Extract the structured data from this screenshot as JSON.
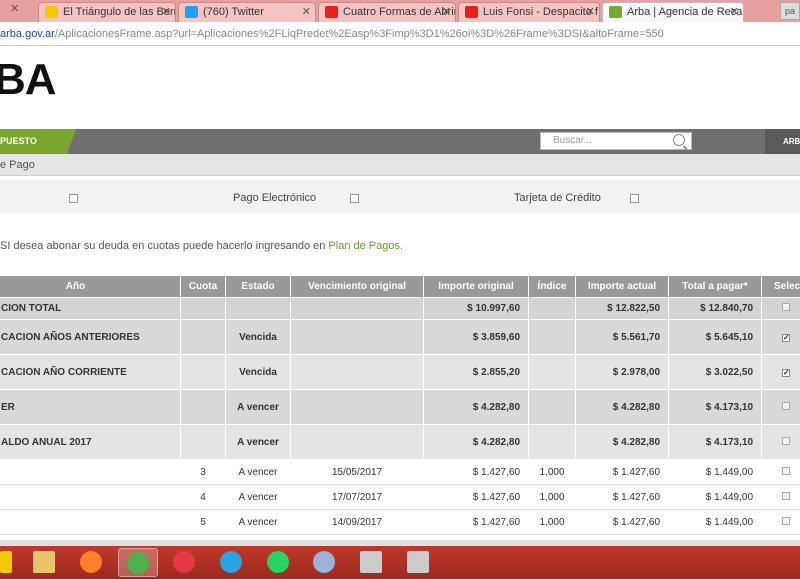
{
  "browser": {
    "tabs": [
      {
        "title": "El Triángulo de las Berm",
        "icon_color": "#f5c800"
      },
      {
        "title": "(760) Twitter",
        "icon_color": "#1da1f2"
      },
      {
        "title": "Cuatro Formas de Abrir",
        "icon_color": "#e62117"
      },
      {
        "title": "Luis Fonsi - Despacito f",
        "icon_color": "#e62117"
      },
      {
        "title": "Arba | Agencia de Recau",
        "icon_color": "#7aa62f",
        "active": true
      }
    ],
    "url_host": "arba.gov.ar",
    "url_path": "/AplicacionesFrame.asp?url=Aplicaciones%2FLiqPredet%2Easp%3Fimp%3D1%26oi%3D%26Frame%3DSI&altoFrame=550",
    "extension_label": "pa"
  },
  "site": {
    "logo": "BA",
    "nav_label": "PUESTO",
    "search_placeholder": "Buscar...",
    "nav_right_label": "ARB",
    "breadcrumb": "e Pago"
  },
  "payment_options": {
    "electronic_label": "Pago Electrónico",
    "card_label": "Tarjeta de Crédito"
  },
  "info": {
    "text": "SI desea abonar su deuda en cuotas puede hacerlo ingresando en",
    "link": "Plan de Pagos."
  },
  "table": {
    "headers": [
      "Año",
      "Cuota",
      "Estado",
      "Vencimiento original",
      "Importe original",
      "Índice",
      "Importe actual",
      "Total a pagar*",
      "Selec"
    ],
    "rows": [
      {
        "kind": "sum",
        "anio": "CION TOTAL",
        "cuota": "",
        "estado": "",
        "venc": "",
        "imp_orig": "$ 10.997,60",
        "indice": "",
        "imp_act": "$ 12.822,50",
        "total": "$ 12.840,70",
        "sel": "box"
      },
      {
        "kind": "grp",
        "anio": "CACION AÑOS ANTERIORES",
        "cuota": "",
        "estado": "Vencida",
        "venc": "",
        "imp_orig": "$ 3.859,60",
        "indice": "",
        "imp_act": "$ 5.561,70",
        "total": "$ 5.645,10",
        "sel": "tick"
      },
      {
        "kind": "grp alt",
        "anio": "CACION AÑO CORRIENTE",
        "cuota": "",
        "estado": "Vencida",
        "venc": "",
        "imp_orig": "$ 2.855,20",
        "indice": "",
        "imp_act": "$ 2.978,00",
        "total": "$ 3.022,50",
        "sel": "tick"
      },
      {
        "kind": "grp",
        "anio": "ER",
        "cuota": "",
        "estado": "A vencer",
        "venc": "",
        "imp_orig": "$ 4.282,80",
        "indice": "",
        "imp_act": "$ 4.282,80",
        "total": "$ 4.173,10",
        "sel": "box"
      },
      {
        "kind": "grp alt",
        "anio": "ALDO ANUAL 2017",
        "cuota": "",
        "estado": "A vencer",
        "venc": "",
        "imp_orig": "$ 4.282,80",
        "indice": "",
        "imp_act": "$ 4.282,80",
        "total": "$ 4.173,10",
        "sel": "box"
      },
      {
        "kind": "quota",
        "anio": "",
        "cuota": "3",
        "estado": "A vencer",
        "venc": "15/05/2017",
        "imp_orig": "$ 1.427,60",
        "indice": "1,000",
        "imp_act": "$ 1.427,60",
        "total": "$ 1.449,00",
        "sel": "box"
      },
      {
        "kind": "quota",
        "anio": "",
        "cuota": "4",
        "estado": "A vencer",
        "venc": "17/07/2017",
        "imp_orig": "$ 1.427,60",
        "indice": "1,000",
        "imp_act": "$ 1.427,60",
        "total": "$ 1.449,00",
        "sel": "box"
      },
      {
        "kind": "quota",
        "anio": "",
        "cuota": "5",
        "estado": "A vencer",
        "venc": "14/09/2017",
        "imp_orig": "$ 1.427,60",
        "indice": "1,000",
        "imp_act": "$ 1.427,60",
        "total": "$ 1.449,00",
        "sel": "box"
      }
    ]
  },
  "taskbar": {
    "apps": [
      {
        "name": "explorer-icon",
        "color": "#e9c46a"
      },
      {
        "name": "firefox-icon",
        "color": "#ff7f2a"
      },
      {
        "name": "chrome-icon",
        "color": "#4caf50",
        "active": true
      },
      {
        "name": "media-app-icon",
        "color": "#e63946"
      },
      {
        "name": "telegram-icon",
        "color": "#2aa3e0"
      },
      {
        "name": "whatsapp-icon",
        "color": "#25d366"
      },
      {
        "name": "paint-icon",
        "color": "#9bb4d6"
      },
      {
        "name": "document-icon",
        "color": "#cccccc"
      },
      {
        "name": "document-icon",
        "color": "#cccccc"
      }
    ]
  }
}
